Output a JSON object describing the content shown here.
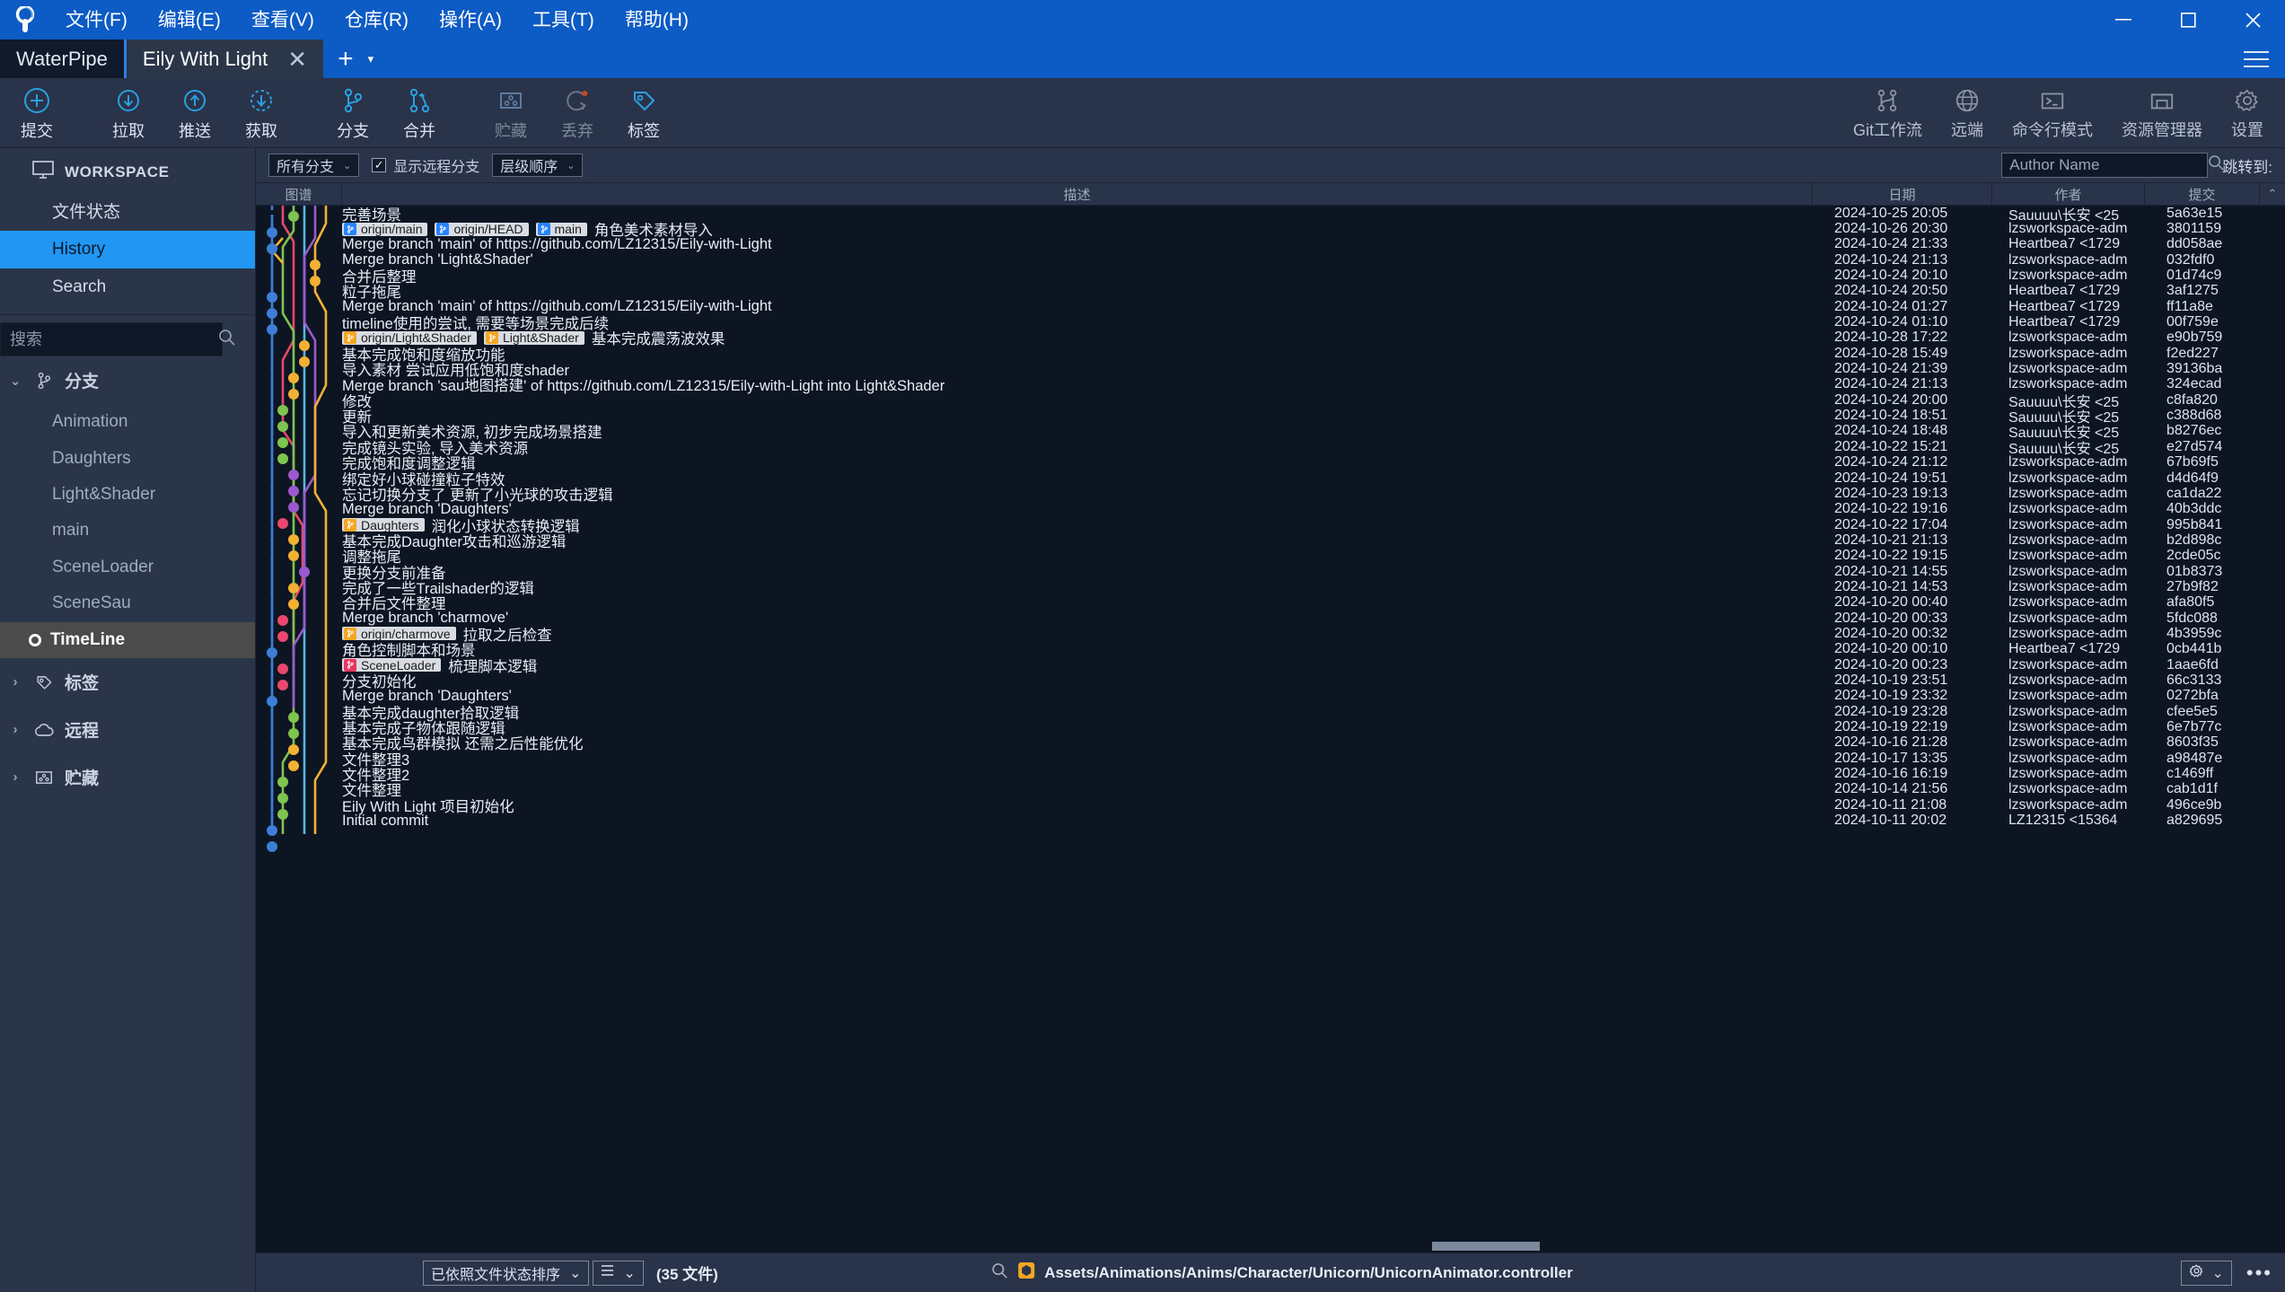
{
  "app": {
    "title": "SourceTree",
    "logo_icon": "sourcetree-logo-icon"
  },
  "menu": {
    "items": [
      {
        "label": "文件(F)",
        "name": "menu-file"
      },
      {
        "label": "编辑(E)",
        "name": "menu-edit"
      },
      {
        "label": "查看(V)",
        "name": "menu-view"
      },
      {
        "label": "仓库(R)",
        "name": "menu-repository"
      },
      {
        "label": "操作(A)",
        "name": "menu-actions"
      },
      {
        "label": "工具(T)",
        "name": "menu-tools"
      },
      {
        "label": "帮助(H)",
        "name": "menu-help"
      }
    ]
  },
  "window_controls": {
    "minimize": "minimize-icon",
    "maximize": "maximize-icon",
    "close": "close-icon"
  },
  "tabs": {
    "items": [
      {
        "label": "WaterPipe",
        "active": false
      },
      {
        "label": "Eily With Light",
        "active": true
      }
    ],
    "close_glyph": "✕",
    "new_tab_glyph": "+",
    "new_tab_caret": "▾"
  },
  "toolbar": {
    "left": [
      {
        "label": "提交",
        "icon": "commit-plus-icon"
      },
      {
        "label": "拉取",
        "icon": "pull-down-arrow-icon"
      },
      {
        "label": "推送",
        "icon": "push-up-arrow-icon"
      },
      {
        "label": "获取",
        "icon": "fetch-dashed-arrow-icon"
      },
      {
        "label": "分支",
        "icon": "branch-icon"
      },
      {
        "label": "合并",
        "icon": "merge-icon"
      },
      {
        "label": "贮藏",
        "icon": "stash-icon",
        "dim": true
      },
      {
        "label": "丢弃",
        "icon": "discard-reset-icon",
        "dim": true
      },
      {
        "label": "标签",
        "icon": "tag-icon"
      }
    ],
    "right": [
      {
        "label": "Git工作流",
        "icon": "gitflow-icon"
      },
      {
        "label": "远端",
        "icon": "globe-remote-icon"
      },
      {
        "label": "命令行模式",
        "icon": "terminal-icon"
      },
      {
        "label": "资源管理器",
        "icon": "explorer-folder-icon"
      },
      {
        "label": "设置",
        "icon": "gear-settings-icon"
      }
    ]
  },
  "sidebar": {
    "workspace_label": "WORKSPACE",
    "workspace_icon": "monitor-icon",
    "items": [
      {
        "label": "文件状态",
        "selected": false
      },
      {
        "label": "History",
        "selected": true
      },
      {
        "label": "Search",
        "selected": false
      }
    ],
    "search": {
      "placeholder": "搜索",
      "value": "",
      "icon": "search-icon"
    },
    "groups": [
      {
        "label": "分支",
        "icon": "branch-icon",
        "expanded": true,
        "twisty": "⌄",
        "children": [
          {
            "label": "Animation",
            "current": false
          },
          {
            "label": "Daughters",
            "current": false
          },
          {
            "label": "Light&Shader",
            "current": false
          },
          {
            "label": "main",
            "current": false
          },
          {
            "label": "SceneLoader",
            "current": false
          },
          {
            "label": "SceneSau",
            "current": false
          },
          {
            "label": "TimeLine",
            "current": true
          }
        ]
      },
      {
        "label": "标签",
        "icon": "tag-icon",
        "expanded": false,
        "twisty": "›",
        "children": []
      },
      {
        "label": "远程",
        "icon": "cloud-icon",
        "expanded": false,
        "twisty": "›",
        "children": []
      },
      {
        "label": "贮藏",
        "icon": "stash-icon",
        "expanded": false,
        "twisty": "›",
        "children": []
      }
    ]
  },
  "filterbar": {
    "branch_filter": {
      "value": "所有分支",
      "caret": "⌄"
    },
    "show_remote": {
      "label": "显示远程分支",
      "checked": true,
      "check_glyph": "✓"
    },
    "order": {
      "value": "层级顺序",
      "caret": "⌄"
    },
    "author_search": {
      "placeholder": "Author Name",
      "value": "",
      "icon": "search-icon"
    },
    "jump_to_label": "跳转到:"
  },
  "columns": {
    "graph": "图谱",
    "description": "描述",
    "date": "日期",
    "author": "作者",
    "commit": "提交",
    "sort_arrow": "⌃"
  },
  "commits": [
    {
      "desc": "完善场景",
      "badges": [],
      "date": "2024-10-25 20:05",
      "author": "Sauuuu\\长安 <25",
      "commit": "5a63e15"
    },
    {
      "desc": "角色美术素材导入",
      "badges": [
        {
          "label": "origin/main",
          "color": "blue"
        },
        {
          "label": "origin/HEAD",
          "color": "blue"
        },
        {
          "label": "main",
          "color": "blue"
        }
      ],
      "date": "2024-10-26 20:30",
      "author": "lzsworkspace-adm",
      "commit": "3801159"
    },
    {
      "desc": "Merge branch 'main' of https://github.com/LZ12315/Eily-with-Light",
      "badges": [],
      "date": "2024-10-24 21:33",
      "author": "Heartbea7 <1729",
      "commit": "dd058ae"
    },
    {
      "desc": "Merge branch 'Light&Shader'",
      "badges": [],
      "date": "2024-10-24 21:13",
      "author": "lzsworkspace-adm",
      "commit": "032fdf0"
    },
    {
      "desc": "合并后整理",
      "badges": [],
      "date": "2024-10-24 20:10",
      "author": "lzsworkspace-adm",
      "commit": "01d74c9"
    },
    {
      "desc": "粒子拖尾",
      "badges": [],
      "date": "2024-10-24 20:50",
      "author": "Heartbea7 <1729",
      "commit": "3af1275"
    },
    {
      "desc": "Merge branch 'main' of https://github.com/LZ12315/Eily-with-Light",
      "badges": [],
      "date": "2024-10-24 01:27",
      "author": "Heartbea7 <1729",
      "commit": "ff11a8e"
    },
    {
      "desc": "timeline使用的尝试, 需要等场景完成后续",
      "badges": [],
      "date": "2024-10-24 01:10",
      "author": "Heartbea7 <1729",
      "commit": "00f759e"
    },
    {
      "desc": "基本完成震荡波效果",
      "badges": [
        {
          "label": "origin/Light&Shader",
          "color": "yellow"
        },
        {
          "label": "Light&Shader",
          "color": "yellow"
        }
      ],
      "date": "2024-10-28 17:22",
      "author": "lzsworkspace-adm",
      "commit": "e90b759"
    },
    {
      "desc": "基本完成饱和度缩放功能",
      "badges": [],
      "date": "2024-10-28 15:49",
      "author": "lzsworkspace-adm",
      "commit": "f2ed227"
    },
    {
      "desc": "导入素材 尝试应用低饱和度shader",
      "badges": [],
      "date": "2024-10-24 21:39",
      "author": "lzsworkspace-adm",
      "commit": "39136ba"
    },
    {
      "desc": "Merge branch 'sau地图搭建' of https://github.com/LZ12315/Eily-with-Light into Light&Shader",
      "badges": [],
      "date": "2024-10-24 21:13",
      "author": "lzsworkspace-adm",
      "commit": "324ecad"
    },
    {
      "desc": "修改",
      "badges": [],
      "date": "2024-10-24 20:00",
      "author": "Sauuuu\\长安 <25",
      "commit": "c8fa820"
    },
    {
      "desc": "更新",
      "badges": [],
      "date": "2024-10-24 18:51",
      "author": "Sauuuu\\长安 <25",
      "commit": "c388d68"
    },
    {
      "desc": "导入和更新美术资源, 初步完成场景搭建",
      "badges": [],
      "date": "2024-10-24 18:48",
      "author": "Sauuuu\\长安 <25",
      "commit": "b8276ec"
    },
    {
      "desc": "完成镜头实验, 导入美术资源",
      "badges": [],
      "date": "2024-10-22 15:21",
      "author": "Sauuuu\\长安 <25",
      "commit": "e27d574"
    },
    {
      "desc": "完成饱和度调整逻辑",
      "badges": [],
      "date": "2024-10-24 21:12",
      "author": "lzsworkspace-adm",
      "commit": "67b69f5"
    },
    {
      "desc": "绑定好小球碰撞粒子特效",
      "badges": [],
      "date": "2024-10-24 19:51",
      "author": "lzsworkspace-adm",
      "commit": "d4d64f9"
    },
    {
      "desc": "忘记切换分支了 更新了小光球的攻击逻辑",
      "badges": [],
      "date": "2024-10-23 19:13",
      "author": "lzsworkspace-adm",
      "commit": "ca1da22"
    },
    {
      "desc": "Merge branch 'Daughters'",
      "badges": [],
      "date": "2024-10-22 19:16",
      "author": "lzsworkspace-adm",
      "commit": "40b3ddc"
    },
    {
      "desc": "润化小球状态转换逻辑",
      "badges": [
        {
          "label": "Daughters",
          "color": "yellow"
        }
      ],
      "date": "2024-10-22 17:04",
      "author": "lzsworkspace-adm",
      "commit": "995b841"
    },
    {
      "desc": "基本完成Daughter攻击和巡游逻辑",
      "badges": [],
      "date": "2024-10-21 21:13",
      "author": "lzsworkspace-adm",
      "commit": "b2d898c"
    },
    {
      "desc": "调整拖尾",
      "badges": [],
      "date": "2024-10-22 19:15",
      "author": "lzsworkspace-adm",
      "commit": "2cde05c"
    },
    {
      "desc": "更换分支前准备",
      "badges": [],
      "date": "2024-10-21 14:55",
      "author": "lzsworkspace-adm",
      "commit": "01b8373"
    },
    {
      "desc": "完成了一些Trailshader的逻辑",
      "badges": [],
      "date": "2024-10-21 14:53",
      "author": "lzsworkspace-adm",
      "commit": "27b9f82"
    },
    {
      "desc": "合并后文件整理",
      "badges": [],
      "date": "2024-10-20 00:40",
      "author": "lzsworkspace-adm",
      "commit": "afa80f5"
    },
    {
      "desc": "Merge branch 'charmove'",
      "badges": [],
      "date": "2024-10-20 00:33",
      "author": "lzsworkspace-adm",
      "commit": "5fdc088"
    },
    {
      "desc": "拉取之后检查",
      "badges": [
        {
          "label": "origin/charmove",
          "color": "yellow"
        }
      ],
      "date": "2024-10-20 00:32",
      "author": "lzsworkspace-adm",
      "commit": "4b3959c"
    },
    {
      "desc": "角色控制脚本和场景",
      "badges": [],
      "date": "2024-10-20 00:10",
      "author": "Heartbea7 <1729",
      "commit": "0cb441b"
    },
    {
      "desc": "梳理脚本逻辑",
      "badges": [
        {
          "label": "SceneLoader",
          "color": "red"
        }
      ],
      "date": "2024-10-20 00:23",
      "author": "lzsworkspace-adm",
      "commit": "1aae6fd"
    },
    {
      "desc": "分支初始化",
      "badges": [],
      "date": "2024-10-19 23:51",
      "author": "lzsworkspace-adm",
      "commit": "66c3133"
    },
    {
      "desc": "Merge branch 'Daughters'",
      "badges": [],
      "date": "2024-10-19 23:32",
      "author": "lzsworkspace-adm",
      "commit": "0272bfa"
    },
    {
      "desc": "基本完成daughter拾取逻辑",
      "badges": [],
      "date": "2024-10-19 23:28",
      "author": "lzsworkspace-adm",
      "commit": "cfee5e5"
    },
    {
      "desc": "基本完成子物体跟随逻辑",
      "badges": [],
      "date": "2024-10-19 22:19",
      "author": "lzsworkspace-adm",
      "commit": "6e7b77c"
    },
    {
      "desc": "基本完成鸟群模拟 还需之后性能优化",
      "badges": [],
      "date": "2024-10-16 21:28",
      "author": "lzsworkspace-adm",
      "commit": "8603f35"
    },
    {
      "desc": "文件整理3",
      "badges": [],
      "date": "2024-10-17 13:35",
      "author": "lzsworkspace-adm",
      "commit": "a98487e"
    },
    {
      "desc": "文件整理2",
      "badges": [],
      "date": "2024-10-16 16:19",
      "author": "lzsworkspace-adm",
      "commit": "c1469ff"
    },
    {
      "desc": "文件整理",
      "badges": [],
      "date": "2024-10-14 21:56",
      "author": "lzsworkspace-adm",
      "commit": "cab1d1f"
    },
    {
      "desc": "Eily With Light 项目初始化",
      "badges": [],
      "date": "2024-10-11 21:08",
      "author": "lzsworkspace-adm",
      "commit": "496ce9b"
    },
    {
      "desc": "Initial commit",
      "badges": [],
      "date": "2024-10-11 20:02",
      "author": "LZ12315 <15364",
      "commit": "a829695"
    }
  ],
  "bottombar": {
    "sort": {
      "value": "已依照文件状态排序",
      "caret": "⌄"
    },
    "view_mode": {
      "icon": "list-view-icon",
      "caret": "⌄"
    },
    "file_count": "(35 文件)",
    "search_icon": "search-icon",
    "path_icon": "unity-file-icon",
    "path": "Assets/Animations/Anims/Character/Unicorn/UnicornAnimator.controller",
    "settings_icon": "gear-settings-icon",
    "settings_caret": "⌄",
    "more_icon": "more-dots-icon"
  }
}
